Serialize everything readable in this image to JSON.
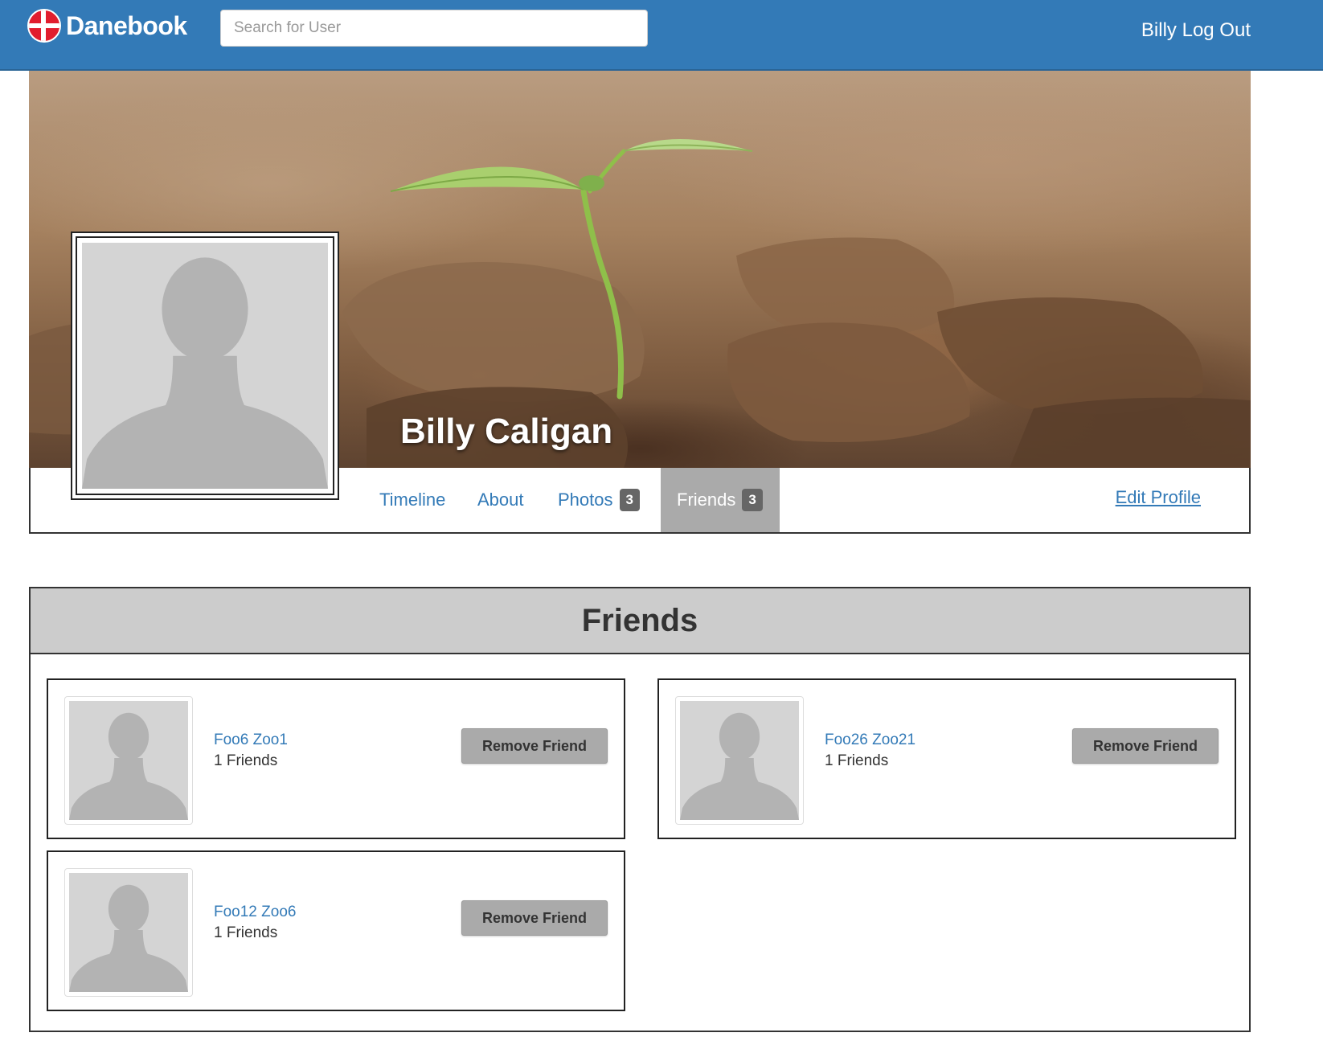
{
  "nav": {
    "brand": "Danebook",
    "search_placeholder": "Search for User",
    "user_name": "Billy",
    "logout_label": "Log Out"
  },
  "profile": {
    "name": "Billy Caligan",
    "tabs": [
      {
        "label": "Timeline"
      },
      {
        "label": "About"
      },
      {
        "label": "Photos",
        "badge": "3"
      },
      {
        "label": "Friends",
        "badge": "3",
        "active": true
      }
    ],
    "edit_profile_label": "Edit Profile"
  },
  "friends": {
    "title": "Friends",
    "remove_label": "Remove Friend",
    "items": [
      {
        "name": "Foo6 Zoo1",
        "count": "1 Friends"
      },
      {
        "name": "Foo26 Zoo21",
        "count": "1 Friends"
      },
      {
        "name": "Foo12 Zoo6",
        "count": "1 Friends"
      }
    ]
  },
  "colors": {
    "nav_bg": "#337ab7",
    "link": "#337ab7",
    "active_tab": "#aaaaaa",
    "header_bg": "#cccccc",
    "badge": "#666666"
  }
}
